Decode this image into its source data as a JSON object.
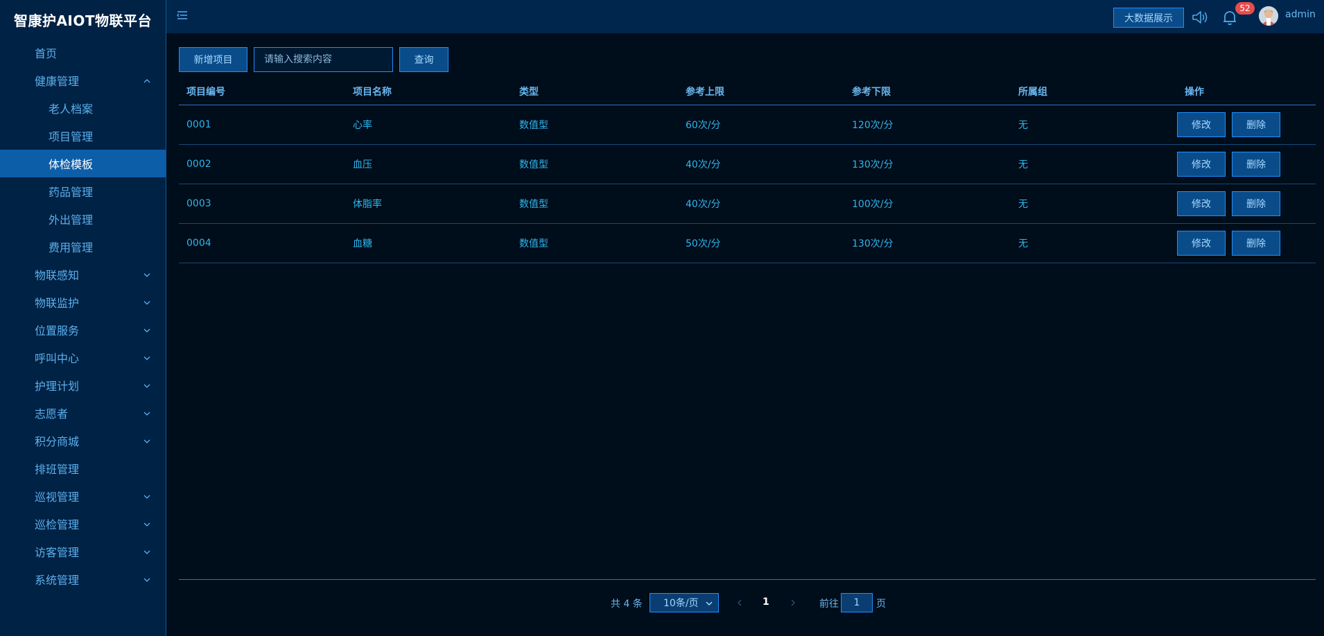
{
  "brand": "智康护AIOT物联平台",
  "sidebar": {
    "items": [
      {
        "label": "首页",
        "level": 1,
        "chevron": "",
        "active": false
      },
      {
        "label": "健康管理",
        "level": 1,
        "chevron": "up",
        "active": false
      },
      {
        "label": "老人档案",
        "level": 2,
        "chevron": "",
        "active": false
      },
      {
        "label": "项目管理",
        "level": 2,
        "chevron": "",
        "active": false
      },
      {
        "label": "体检模板",
        "level": 2,
        "chevron": "",
        "active": true
      },
      {
        "label": "药品管理",
        "level": 2,
        "chevron": "",
        "active": false
      },
      {
        "label": "外出管理",
        "level": 2,
        "chevron": "",
        "active": false
      },
      {
        "label": "费用管理",
        "level": 2,
        "chevron": "",
        "active": false
      },
      {
        "label": "物联感知",
        "level": 1,
        "chevron": "down",
        "active": false
      },
      {
        "label": "物联监护",
        "level": 1,
        "chevron": "down",
        "active": false
      },
      {
        "label": "位置服务",
        "level": 1,
        "chevron": "down",
        "active": false
      },
      {
        "label": "呼叫中心",
        "level": 1,
        "chevron": "down",
        "active": false
      },
      {
        "label": "护理计划",
        "level": 1,
        "chevron": "down",
        "active": false
      },
      {
        "label": "志愿者",
        "level": 1,
        "chevron": "down",
        "active": false
      },
      {
        "label": "积分商城",
        "level": 1,
        "chevron": "down",
        "active": false
      },
      {
        "label": "排班管理",
        "level": 1,
        "chevron": "",
        "active": false
      },
      {
        "label": "巡视管理",
        "level": 1,
        "chevron": "down",
        "active": false
      },
      {
        "label": "巡检管理",
        "level": 1,
        "chevron": "down",
        "active": false
      },
      {
        "label": "访客管理",
        "level": 1,
        "chevron": "down",
        "active": false
      },
      {
        "label": "系统管理",
        "level": 1,
        "chevron": "down",
        "active": false
      }
    ]
  },
  "header": {
    "bigdata_label": "大数据展示",
    "notification_count": "52",
    "username": "admin"
  },
  "toolbar": {
    "add_label": "新增项目",
    "search_placeholder": "请输入搜索内容",
    "query_label": "查询"
  },
  "table": {
    "columns": [
      "项目编号",
      "项目名称",
      "类型",
      "参考上限",
      "参考下限",
      "所属组",
      "操作"
    ],
    "rows": [
      {
        "id": "0001",
        "name": "心率",
        "type": "数值型",
        "upper": "60次/分",
        "lower": "120次/分",
        "group": "无"
      },
      {
        "id": "0002",
        "name": "血压",
        "type": "数值型",
        "upper": "40次/分",
        "lower": "130次/分",
        "group": "无"
      },
      {
        "id": "0003",
        "name": "体脂率",
        "type": "数值型",
        "upper": "40次/分",
        "lower": "100次/分",
        "group": "无"
      },
      {
        "id": "0004",
        "name": "血糖",
        "type": "数值型",
        "upper": "50次/分",
        "lower": "130次/分",
        "group": "无"
      }
    ],
    "edit_label": "修改",
    "delete_label": "删除"
  },
  "pagination": {
    "total": "共 4 条",
    "page_size": "10条/页",
    "current_page": "1",
    "goto_label": "前往",
    "goto_value": "1",
    "page_suffix": "页"
  },
  "colors": {
    "background": "#000d1a",
    "sidebar": "#002244",
    "active": "#0c5ea8",
    "accent": "#1e90ff",
    "badge": "#e84c4c"
  }
}
